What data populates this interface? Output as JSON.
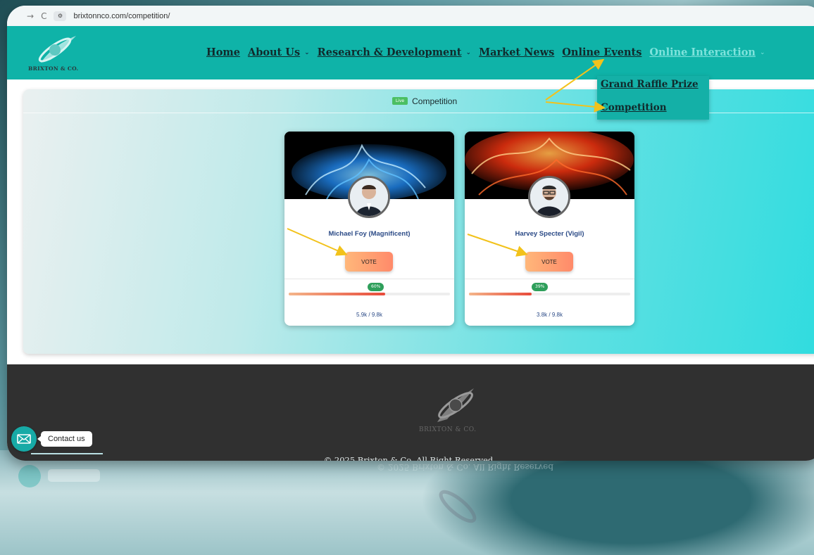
{
  "browser": {
    "url": "brixtonnco.com/competition/"
  },
  "brand": {
    "logo_text": "BRIXTON & CO."
  },
  "nav": {
    "items": [
      {
        "label": "Home"
      },
      {
        "label": "About Us"
      },
      {
        "label": "Research & Development"
      },
      {
        "label": "Market News"
      },
      {
        "label": "Online Events"
      },
      {
        "label": "Online Interaction"
      }
    ],
    "dropdown": [
      "Grand Raffle Prize",
      "Competition"
    ]
  },
  "competition": {
    "live_badge": "Live",
    "title": "Competition",
    "candidates": [
      {
        "name": "Michael Foy (Magnificent)",
        "vote_label": "VOTE",
        "percent_label": "60%",
        "progress": 0.6,
        "count": "5.9k / 9.8k",
        "banner": "blue"
      },
      {
        "name": "Harvey Specter (Vigil)",
        "vote_label": "VOTE",
        "percent_label": "39%",
        "progress": 0.39,
        "count": "3.8k / 9.8k",
        "banner": "red"
      }
    ]
  },
  "footer": {
    "logo_text": "BRIXTON & CO.",
    "copyright": "© 2025 Brixton & Co. All Right Reserved"
  },
  "contact": {
    "label": "Contact us"
  },
  "colors": {
    "header": "#0fb3a8",
    "footer": "#303030",
    "annotation_arrow": "#f2c21b"
  }
}
